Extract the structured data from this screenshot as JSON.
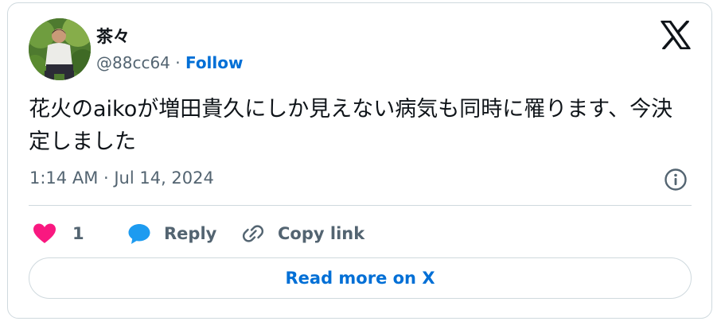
{
  "user": {
    "display_name": "茶々",
    "handle": "@88cc64",
    "separator": " · ",
    "follow_label": "Follow"
  },
  "tweet": {
    "text": "花火のaikoが増田貴久にしか見えない病気も同時に罹ります、今決定しました",
    "timestamp": "1:14 AM · Jul 14, 2024"
  },
  "actions": {
    "like_count": "1",
    "reply_label": "Reply",
    "copy_label": "Copy link"
  },
  "read_more_label": "Read more on X",
  "colors": {
    "like": "#f91880",
    "reply": "#1d9bf0",
    "link": "#006fd6",
    "muted": "#536471",
    "border": "#cfd9de"
  },
  "icons": [
    "x-logo-icon",
    "info-icon",
    "heart-icon",
    "reply-bubble-icon",
    "link-icon"
  ]
}
